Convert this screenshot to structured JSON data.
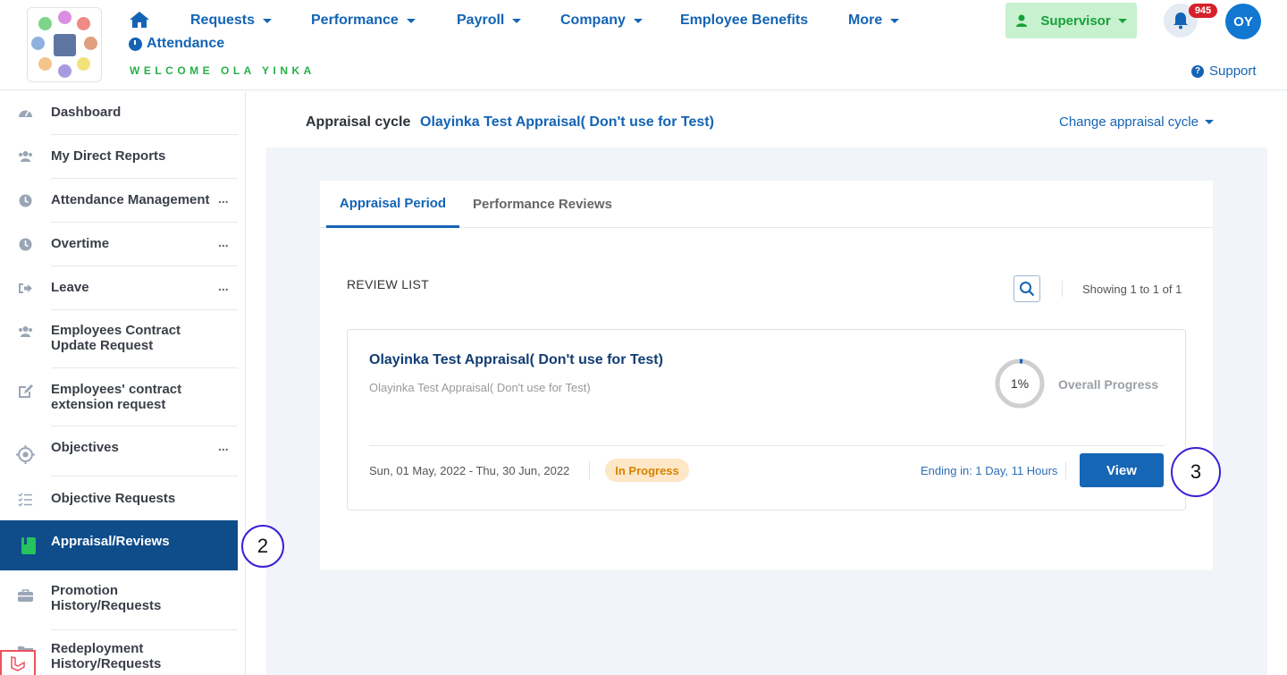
{
  "header": {
    "nav": [
      {
        "label": "Requests",
        "has_caret": true
      },
      {
        "label": "Performance",
        "has_caret": true
      },
      {
        "label": "Payroll",
        "has_caret": true
      },
      {
        "label": "Company",
        "has_caret": true
      },
      {
        "label": "Employee Benefits",
        "has_caret": false
      },
      {
        "label": "More",
        "has_caret": true
      }
    ],
    "attendance_label": "Attendance",
    "welcome": "WELCOME OLA YINKA",
    "role_label": "Supervisor",
    "notification_count": "945",
    "avatar_initials": "OY",
    "support_label": "Support"
  },
  "sidebar": {
    "items": [
      {
        "label": "Dashboard",
        "icon": "dashboard-icon",
        "more": ""
      },
      {
        "label": "My Direct Reports",
        "icon": "users-icon",
        "more": ""
      },
      {
        "label": "Attendance Management",
        "icon": "clock-icon",
        "more": "..."
      },
      {
        "label": "Overtime",
        "icon": "clock-icon",
        "more": "..."
      },
      {
        "label": "Leave",
        "icon": "sign-out-icon",
        "more": "..."
      },
      {
        "label": "Employees Contract Update Request",
        "icon": "users-icon",
        "more": ""
      },
      {
        "label": "Employees' contract extension request",
        "icon": "edit-icon",
        "more": ""
      },
      {
        "label": "Objectives",
        "icon": "crosshair-icon",
        "more": "..."
      },
      {
        "label": "Objective Requests",
        "icon": "list-check-icon",
        "more": ""
      },
      {
        "label": "Appraisal/Reviews",
        "icon": "book-icon",
        "more": ""
      },
      {
        "label": "Promotion History/Requests",
        "icon": "briefcase-icon",
        "more": ""
      },
      {
        "label": "Redeployment History/Requests",
        "icon": "folder-icon",
        "more": ""
      }
    ]
  },
  "main": {
    "cycle_label": "Appraisal cycle",
    "cycle_value": "Olayinka Test Appraisal( Don't use for Test)",
    "change_cycle_label": "Change appraisal cycle",
    "tabs": [
      {
        "label": "Appraisal Period",
        "active": true
      },
      {
        "label": "Performance Reviews",
        "active": false
      }
    ],
    "review_list_title": "REVIEW LIST",
    "showing_text": "Showing 1 to 1 of 1",
    "review": {
      "title": "Olayinka Test Appraisal( Don't use for Test)",
      "subtitle": "Olayinka Test Appraisal( Don't use for Test)",
      "progress": 1,
      "progress_text": "1%",
      "progress_label": "Overall Progress",
      "dates": "Sun, 01 May, 2022 - Thu, 30 Jun, 2022",
      "status": "In Progress",
      "ending": "Ending in: 1 Day, 11 Hours",
      "view_label": "View"
    }
  },
  "annotations": {
    "marker_2": "2",
    "marker_3": "3"
  },
  "colors": {
    "primary": "#1464b5",
    "sidebar_active": "#0f4c8a",
    "supervisor_bg": "#c8f1cf",
    "badge": "#d7202a",
    "status_bg": "#fde7c7",
    "status_text": "#d98300"
  }
}
